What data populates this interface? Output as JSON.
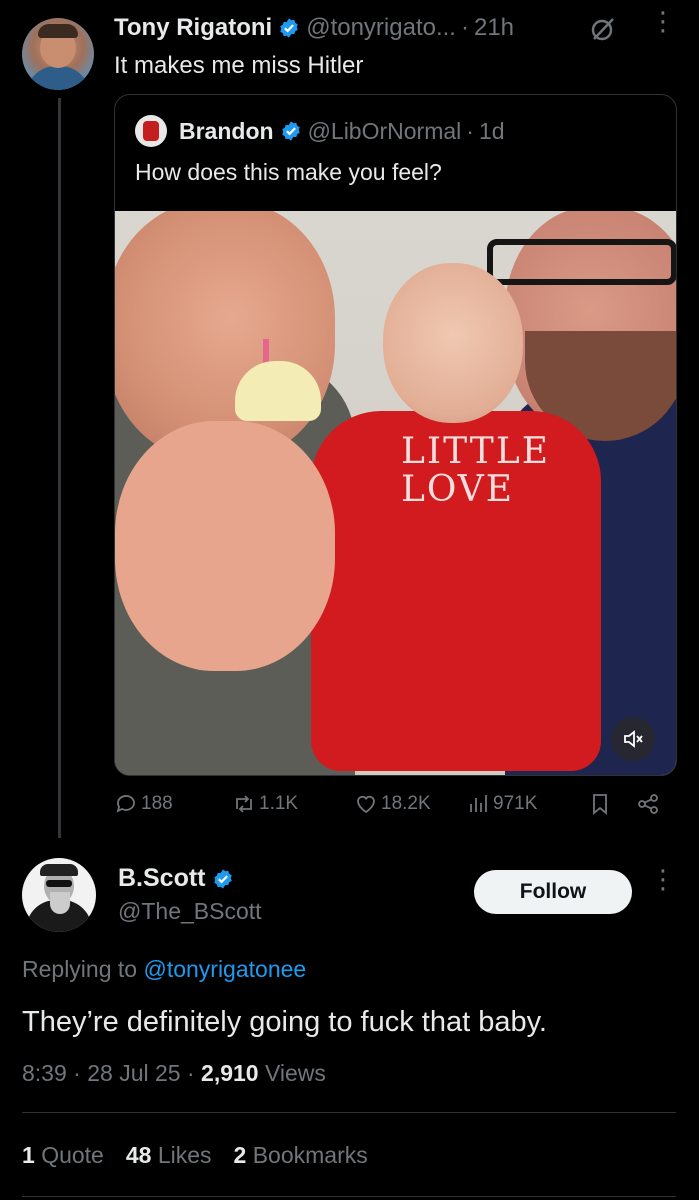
{
  "tweet1": {
    "name": "Tony Rigatoni",
    "handle": "@tonyrigato...",
    "sep": "·",
    "time": "21h",
    "text": "It makes me miss Hitler",
    "more": "⋮"
  },
  "quote": {
    "name": "Brandon",
    "handle": "@LibOrNormal",
    "sep": "·",
    "time": "1d",
    "text": "How does this make you feel?",
    "shirt_text_line1": "LITTLE",
    "shirt_text_line2": "LOVE"
  },
  "actions": {
    "replies": "188",
    "reposts": "1.1K",
    "likes": "18.2K",
    "views": "971K"
  },
  "reply": {
    "name": "B.Scott",
    "handle": "@The_BScott",
    "follow_label": "Follow",
    "more": "⋮",
    "replying_prefix": "Replying to",
    "replying_to": "@tonyrigatonee",
    "text": "They’re definitely going to fuck that baby.",
    "time": "8:39",
    "sep1": "·",
    "date": "28 Jul 25",
    "sep2": "·",
    "views_count": "2,910",
    "views_label": "Views"
  },
  "stats": {
    "quotes_count": "1",
    "quotes_label": "Quote",
    "likes_count": "48",
    "likes_label": "Likes",
    "bookmarks_count": "2",
    "bookmarks_label": "Bookmarks"
  },
  "colors": {
    "background": "#000000",
    "text": "#e7e9ea",
    "muted": "#71767b",
    "link": "#1d9bf0",
    "verified": "#1d9bf0",
    "border": "#2f3336"
  }
}
